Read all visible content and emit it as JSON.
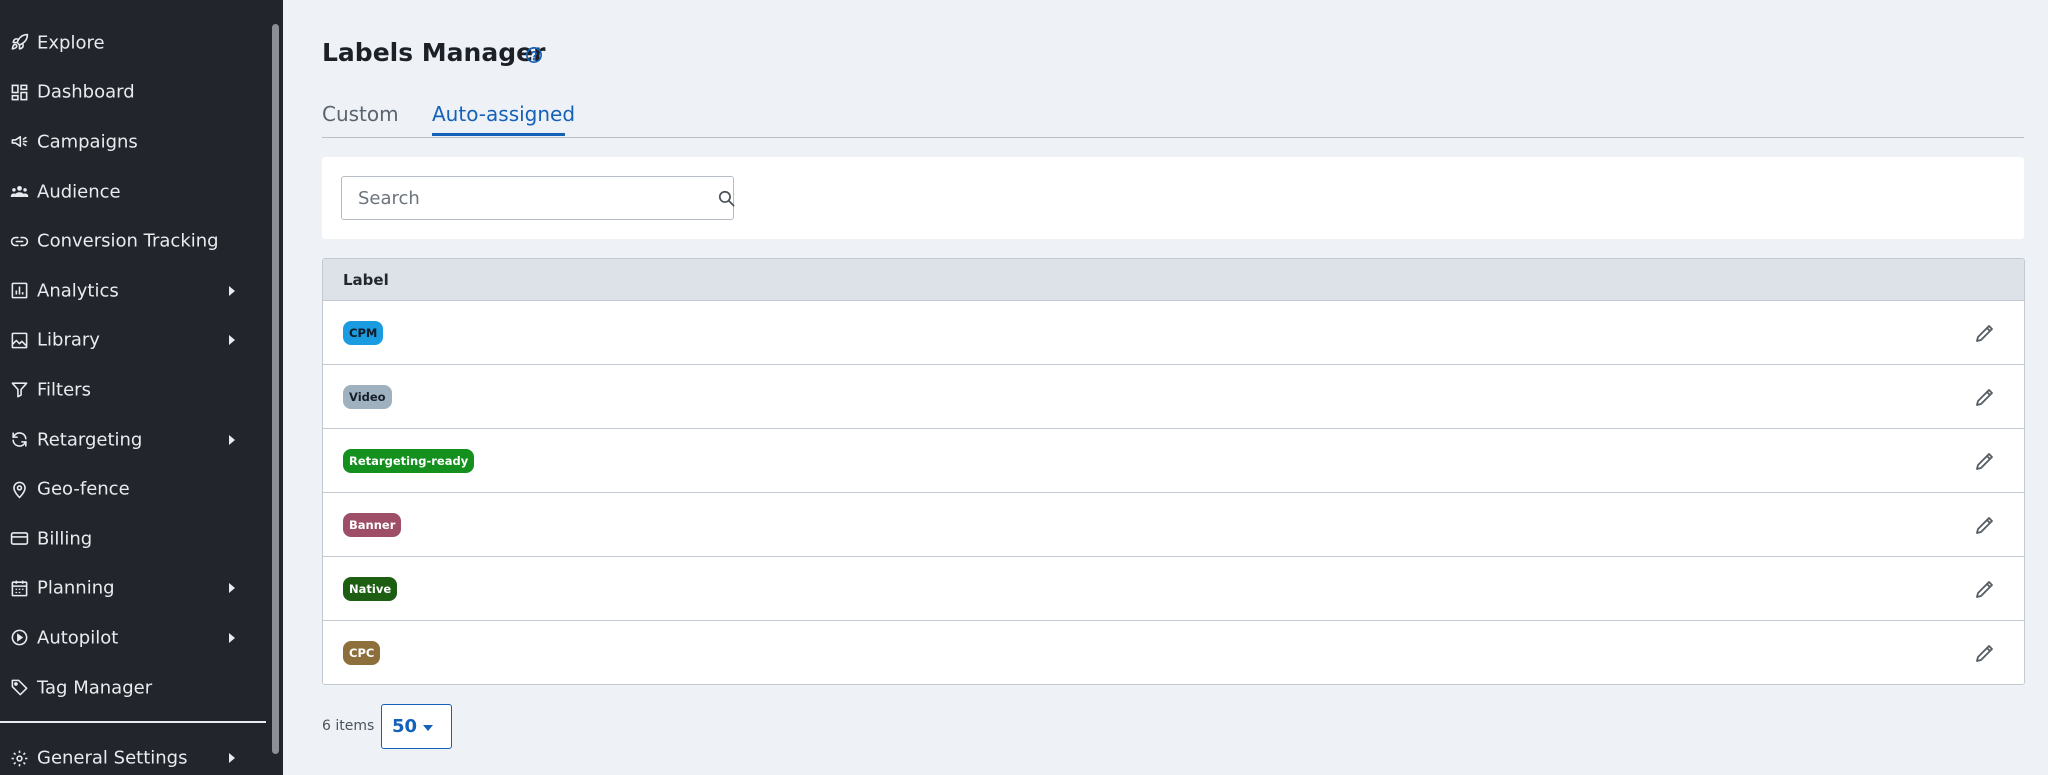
{
  "sidebar": {
    "items": [
      {
        "label": "Explore",
        "icon": "rocket-icon",
        "has_submenu": false
      },
      {
        "label": "Dashboard",
        "icon": "dashboard-icon",
        "has_submenu": false
      },
      {
        "label": "Campaigns",
        "icon": "megaphone-icon",
        "has_submenu": false
      },
      {
        "label": "Audience",
        "icon": "audience-icon",
        "has_submenu": false
      },
      {
        "label": "Conversion Tracking",
        "icon": "link-icon",
        "has_submenu": false
      },
      {
        "label": "Analytics",
        "icon": "analytics-icon",
        "has_submenu": true
      },
      {
        "label": "Library",
        "icon": "image-icon",
        "has_submenu": true
      },
      {
        "label": "Filters",
        "icon": "filter-icon",
        "has_submenu": false
      },
      {
        "label": "Retargeting",
        "icon": "refresh-icon",
        "has_submenu": true
      },
      {
        "label": "Geo-fence",
        "icon": "map-pin-icon",
        "has_submenu": false
      },
      {
        "label": "Billing",
        "icon": "credit-card-icon",
        "has_submenu": false
      },
      {
        "label": "Planning",
        "icon": "calendar-icon",
        "has_submenu": true
      },
      {
        "label": "Autopilot",
        "icon": "play-circle-icon",
        "has_submenu": true
      },
      {
        "label": "Tag Manager",
        "icon": "tag-icon",
        "has_submenu": false
      }
    ],
    "settings": {
      "label": "General Settings",
      "icon": "gear-icon",
      "has_submenu": true
    }
  },
  "page": {
    "title": "Labels Manager",
    "help_icon": "help-circle-icon"
  },
  "tabs": [
    {
      "label": "Custom",
      "active": false
    },
    {
      "label": "Auto-assigned",
      "active": true
    }
  ],
  "search": {
    "placeholder": "Search",
    "value": "",
    "icon": "search-icon"
  },
  "table": {
    "header": "Label",
    "rows": [
      {
        "label": "CPM",
        "bg": "#1b9be0",
        "fg": "#0e1a24"
      },
      {
        "label": "Video",
        "bg": "#9fb0bf",
        "fg": "#15202a"
      },
      {
        "label": "Retargeting-ready",
        "bg": "#13901d",
        "fg": "#ffffff"
      },
      {
        "label": "Banner",
        "bg": "#9e4e66",
        "fg": "#ffffff"
      },
      {
        "label": "Native",
        "bg": "#1d5e12",
        "fg": "#ffffff"
      },
      {
        "label": "CPC",
        "bg": "#8c6f3b",
        "fg": "#ffffff"
      }
    ],
    "row_action_icon": "pencil-icon"
  },
  "pagination": {
    "items_text": "6 items",
    "page_size": "50"
  },
  "colors": {
    "sidebar_bg": "#22262c",
    "accent": "#1461b8",
    "page_bg": "#eef2f7"
  }
}
